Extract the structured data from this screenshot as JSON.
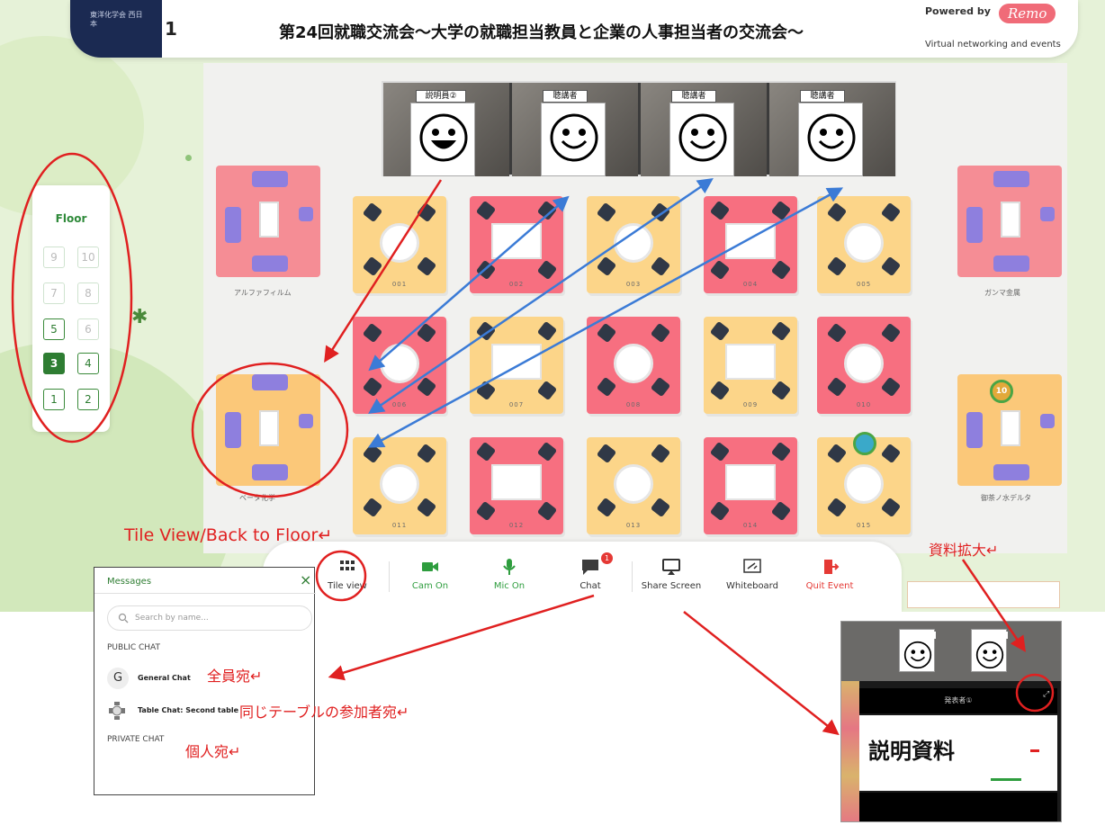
{
  "header": {
    "number": "1",
    "title": "第24回就職交流会〜大学の就職担当教員と企業の人事担当者の交流会〜",
    "powered_by": "Powered by",
    "brand": "Remo",
    "brand_sub": "Virtual networking and events",
    "org_logo_text": "東洋化学会 西日本"
  },
  "video_tiles": [
    {
      "label": "説明員②"
    },
    {
      "label": "聴講者"
    },
    {
      "label": "聴講者"
    },
    {
      "label": "聴講者"
    }
  ],
  "floor_panel": {
    "title": "Floor",
    "buttons": [
      "9",
      "10",
      "7",
      "8",
      "5",
      "6",
      "3",
      "4",
      "1",
      "2"
    ],
    "active": "3"
  },
  "rooms": {
    "corner": [
      "アルファフィルム",
      "ガンマ金属",
      "ベータ化学",
      "御茶ノ水デルタ"
    ],
    "tables": [
      "001",
      "002",
      "003",
      "004",
      "005",
      "006",
      "007",
      "008",
      "009",
      "010",
      "011",
      "012",
      "013",
      "014",
      "015"
    ],
    "badge_number": "10"
  },
  "toolbar": {
    "tile_view": "Tile view",
    "cam_on": "Cam On",
    "mic_on": "Mic On",
    "chat": "Chat",
    "chat_badge": "1",
    "share_screen": "Share Screen",
    "whiteboard": "Whiteboard",
    "quit_event": "Quit Event"
  },
  "messages": {
    "title": "Messages",
    "close": "×",
    "search_placeholder": "Search by name...",
    "public_chat": "PUBLIC CHAT",
    "general_avatar": "G",
    "general_chat": "General Chat",
    "table_chat": "Table Chat: Second table",
    "private_chat": "PRIVATE CHAT"
  },
  "annotations": {
    "tile_view": "Tile View/Back to Floor↵",
    "all": "全員宛↵",
    "same_table": "同じテーブルの参加者宛↵",
    "personal": "個人宛↵",
    "enlarge": "資料拡大↵"
  },
  "zoom_preview": {
    "presenter_bar": "発表者①",
    "slide_text": "説明資料"
  },
  "colors": {
    "accent_green": "#2e7d32",
    "room_yellow": "#fcd589",
    "room_pink": "#f76f80",
    "annotation_red": "#e02020",
    "arrow_blue": "#3b7bd6",
    "quit_red": "#e53935",
    "remo_pink": "#f06b78"
  }
}
